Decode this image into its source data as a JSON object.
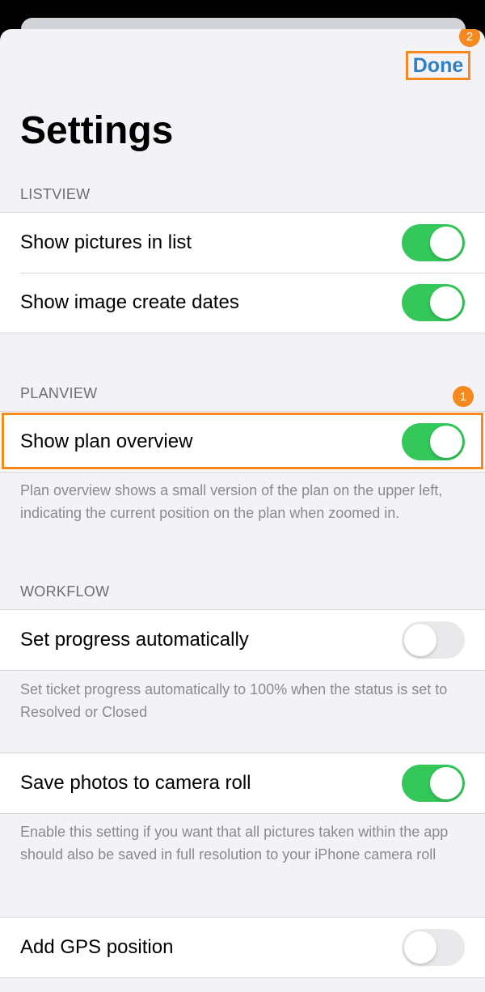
{
  "nav": {
    "done_label": "Done",
    "done_badge": "2"
  },
  "page": {
    "title": "Settings"
  },
  "sections": {
    "listview": {
      "header": "LISTVIEW",
      "rows": [
        {
          "label": "Show pictures in list",
          "on": true
        },
        {
          "label": "Show image create dates",
          "on": true
        }
      ]
    },
    "planview": {
      "header": "PLANVIEW",
      "badge": "1",
      "rows": [
        {
          "label": "Show plan overview",
          "on": true
        }
      ],
      "footer": "Plan overview shows a small version of the plan on the upper left, indicating the current position on the plan when zoomed in."
    },
    "workflow": {
      "header": "WORKFLOW",
      "rows": [
        {
          "label": "Set progress automatically",
          "on": false
        }
      ],
      "footer": "Set ticket progress automatically to 100% when the status is set to Resolved or Closed"
    },
    "photos": {
      "rows": [
        {
          "label": "Save photos to camera roll",
          "on": true
        }
      ],
      "footer": "Enable this setting if you want that all pictures taken within the app should also be saved in full resolution to your iPhone camera roll"
    },
    "gps": {
      "rows": [
        {
          "label": "Add GPS position",
          "on": false
        }
      ]
    }
  },
  "colors": {
    "accent": "#2f80c3",
    "toggle_on": "#34c759",
    "highlight": "#f5891e"
  }
}
